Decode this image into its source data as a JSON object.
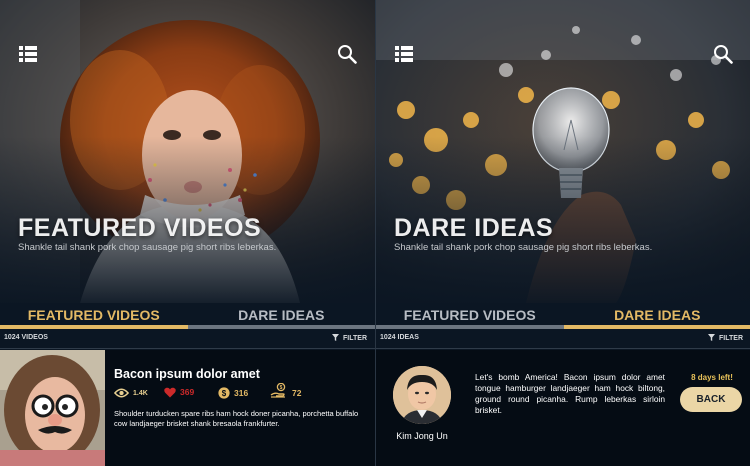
{
  "left_screen": {
    "hero": {
      "title": "FEATURED VIDEOS",
      "subtitle": "Shankle tail shank pork chop sausage pig short ribs leberkas.",
      "menu_icon": "grid-list-icon",
      "search_icon": "search-icon"
    },
    "tabs": [
      {
        "label": "FEATURED VIDEOS",
        "active": true
      },
      {
        "label": "DARE IDEAS",
        "active": false
      }
    ],
    "count_label": "1024 VIDEOS",
    "filter_label": "FILTER",
    "video": {
      "title": "Bacon ipsum dolor amet",
      "views": "1.4K",
      "likes": "369",
      "earnings": "316",
      "donations": "72",
      "description": "Shoulder turducken spare ribs ham hock doner picanha, porchetta buffalo cow landjaeger brisket shank bresaola frankfurter."
    }
  },
  "right_screen": {
    "hero": {
      "title": "DARE IDEAS",
      "subtitle": "Shankle tail shank pork chop sausage pig short ribs leberkas.",
      "menu_icon": "grid-list-icon",
      "search_icon": "search-icon"
    },
    "tabs": [
      {
        "label": "FEATURED VIDEOS",
        "active": false
      },
      {
        "label": "DARE IDEAS",
        "active": true
      }
    ],
    "count_label": "1024 IDEAS",
    "filter_label": "FILTER",
    "idea": {
      "author": "Kim Jong Un",
      "text": "Let's bomb America! Bacon ipsum dolor amet tongue hamburger landjaeger ham hock biltong, ground round picanha. Rump leberkas sirloin brisket.",
      "days_left": "8 days left!",
      "back_label": "BACK"
    }
  },
  "colors": {
    "background": "#0b1623",
    "accent_gold": "#e3b965",
    "inactive_tab": "#b7bcc3",
    "views": "#e7cf91",
    "likes": "#cc2a2a",
    "earnings": "#e3b965",
    "button_bg": "#ebd6a6"
  }
}
